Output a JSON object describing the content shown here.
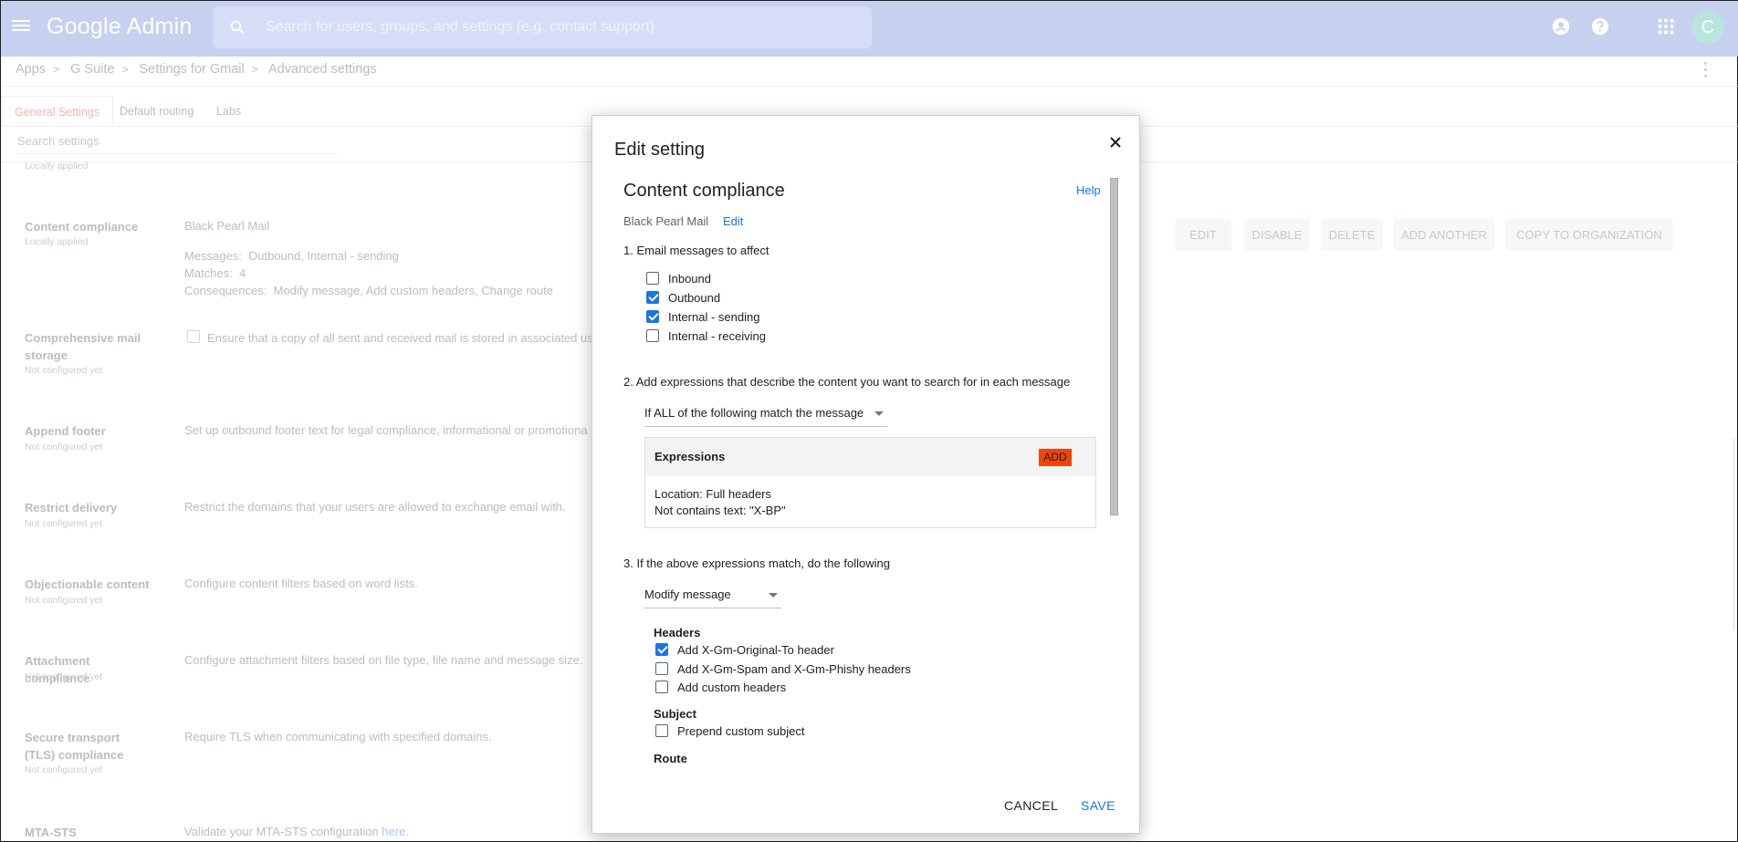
{
  "topbar": {
    "logo_text": "Google Admin",
    "search_placeholder": "Search for users, groups, and settings (e.g. contact support)",
    "avatar_letter": "C",
    "icons": [
      "menu-icon",
      "search-icon",
      "account-circle-icon",
      "help-icon",
      "apps-grid-icon"
    ]
  },
  "breadcrumb": {
    "items": [
      "Apps",
      "G Suite",
      "Settings for Gmail",
      "Advanced settings"
    ]
  },
  "tabs": [
    "General Settings",
    "Default routing",
    "Labs"
  ],
  "bg_search_placeholder": "Search settings",
  "top_partial_sub": "Locally applied",
  "settings_rows": [
    {
      "title": "Content compliance",
      "sub": "Locally applied",
      "desc": "Black Pearl Mail"
    },
    {
      "title": "Comprehensive mail storage",
      "sub": "Not configured yet",
      "desc": "Ensure that a copy of all sent and received mail is stored in associated us"
    },
    {
      "title": "Append footer",
      "sub": "Not configured yet",
      "desc": "Set up outbound footer text for legal compliance, informational or promotiona"
    },
    {
      "title": "Restrict delivery",
      "sub": "Not configured yet",
      "desc": "Restrict the domains that your users are allowed to exchange email with."
    },
    {
      "title": "Objectionable content",
      "sub": "Not configured yet",
      "desc": "Configure content filters based on word lists."
    },
    {
      "title": "Attachment compliance",
      "sub": "Not configured yet",
      "desc": "Configure attachment filters based on file type, file name and message size."
    },
    {
      "title": "Secure transport (TLS) compliance",
      "sub": "Not configured yet",
      "desc": "Require TLS when communicating with specified domains."
    },
    {
      "title": "MTA-STS",
      "sub": "",
      "desc": "Validate your MTA-STS configuration",
      "link": "here",
      "suffix": "."
    }
  ],
  "content_compliance_details": {
    "messages_label": "Messages:",
    "messages_value": "Outbound, Internal - sending",
    "matches_label": "Matches:",
    "matches_value": "4",
    "consequences_label": "Consequences:",
    "consequences_value": "Modify message, Add custom headers, Change route"
  },
  "action_buttons": [
    "EDIT",
    "DISABLE",
    "DELETE",
    "ADD ANOTHER",
    "COPY TO ORGANIZATION"
  ],
  "dialog": {
    "title": "Edit setting",
    "section_title": "Content compliance",
    "help_link": "Help",
    "org_name": "Black Pearl Mail",
    "edit_link": "Edit",
    "step1": "1. Email messages to affect",
    "affect_options": [
      {
        "label": "Inbound",
        "checked": false
      },
      {
        "label": "Outbound",
        "checked": true
      },
      {
        "label": "Internal - sending",
        "checked": true
      },
      {
        "label": "Internal - receiving",
        "checked": false
      }
    ],
    "step2": "2. Add expressions that describe the content you want to search for in each message",
    "match_dropdown": "If ALL of the following match the message",
    "expressions_label": "Expressions",
    "add_button": "ADD",
    "expression_location": "Location:  Full headers",
    "expression_text": "Not contains text:  \"X-BP\"",
    "step3": "3. If the above expressions match, do the following",
    "action_dropdown": "Modify message",
    "headers_heading": "Headers",
    "header_options": [
      {
        "label": "Add X-Gm-Original-To header",
        "checked": true
      },
      {
        "label": "Add X-Gm-Spam and X-Gm-Phishy headers",
        "checked": false
      },
      {
        "label": "Add custom headers",
        "checked": false
      }
    ],
    "subject_heading": "Subject",
    "subject_option": {
      "label": "Prepend custom subject",
      "checked": false
    },
    "route_heading": "Route",
    "cancel_label": "CANCEL",
    "save_label": "SAVE"
  },
  "colors": {
    "topbar": "#c6d1f0",
    "accent": "#1a73e8",
    "add_button": "#ee4608"
  }
}
